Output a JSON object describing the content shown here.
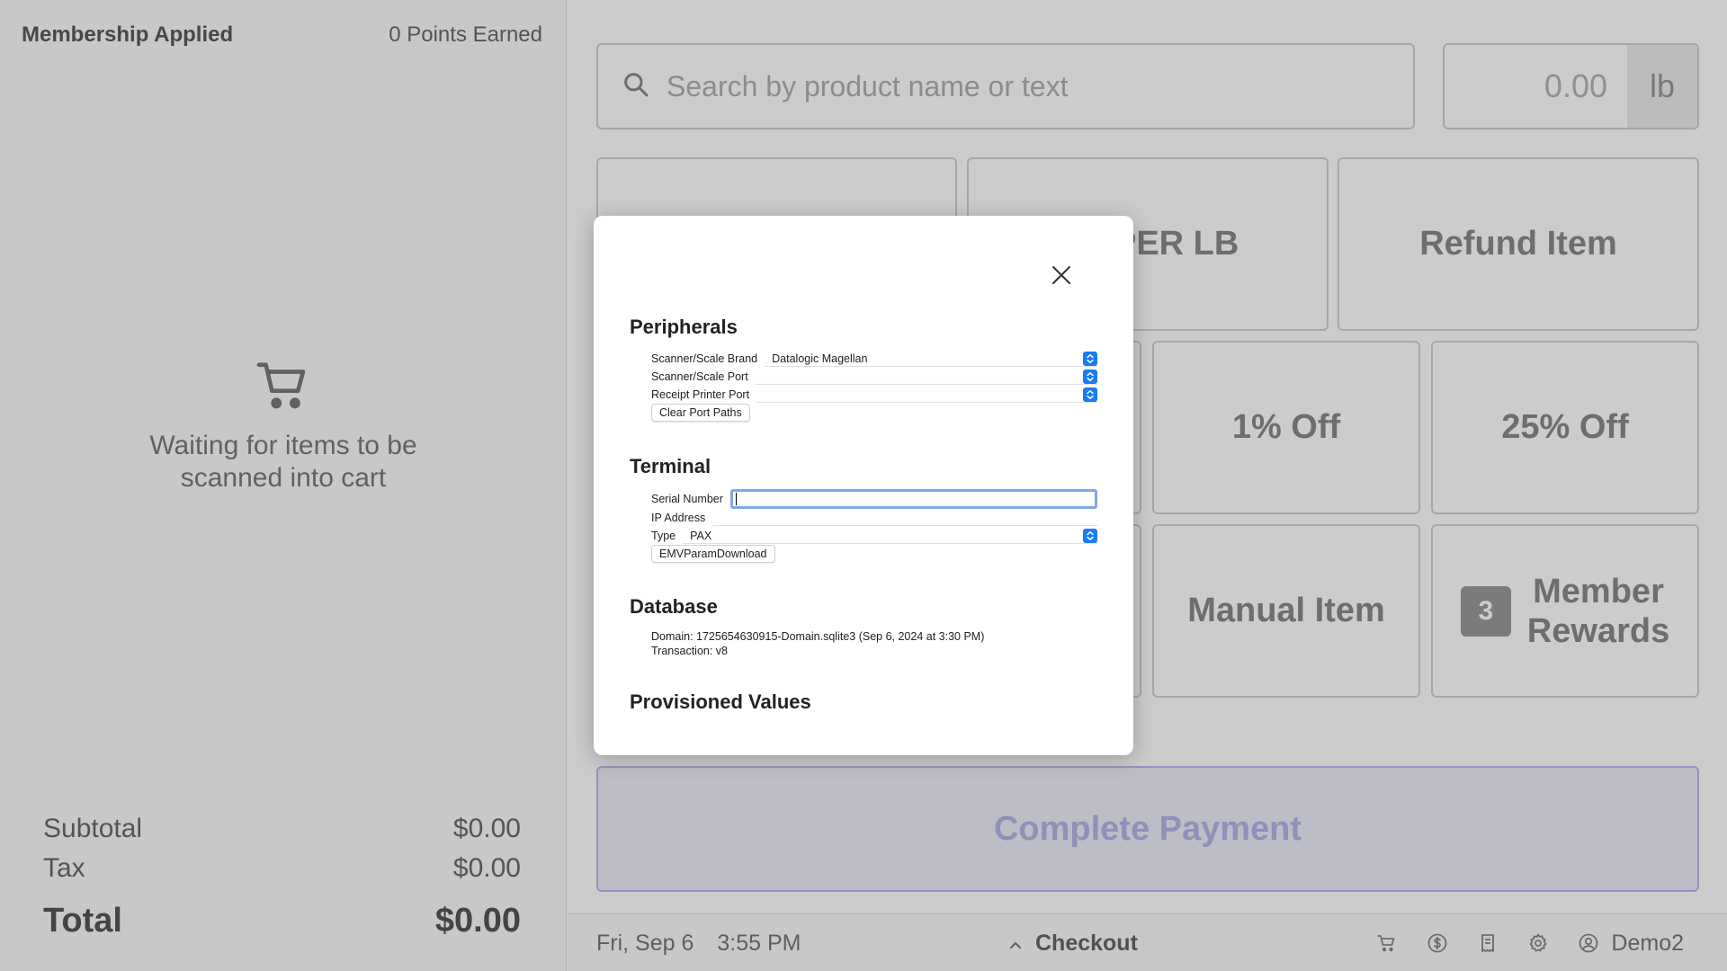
{
  "cart": {
    "membership": "Membership Applied",
    "points": "0 Points Earned",
    "empty_line1": "Waiting for items to be",
    "empty_line2": "scanned into cart",
    "subtotal_label": "Subtotal",
    "subtotal_value": "$0.00",
    "tax_label": "Tax",
    "tax_value": "$0.00",
    "total_label": "Total",
    "total_value": "$0.00"
  },
  "search": {
    "placeholder": "Search by product name or text",
    "icon": "search-icon"
  },
  "weight": {
    "value": "0.00",
    "unit": "lb"
  },
  "tiles": {
    "price_per_lb": "CE PER LB",
    "refund": "Refund Item",
    "one_pct": "1% Off",
    "twenty_five_pct": "25% Off",
    "manual": "Manual Item",
    "rewards_count": "3",
    "rewards_line1": "Member",
    "rewards_line2": "Rewards"
  },
  "pay": {
    "label": "Complete Payment"
  },
  "statusbar": {
    "date": "Fri, Sep 6",
    "time": "3:55 PM",
    "checkout": "Checkout",
    "user": "Demo2",
    "icons": [
      "cart-icon",
      "dollar-icon",
      "receipt-icon",
      "gear-icon",
      "user-icon"
    ]
  },
  "modal": {
    "peripherals": {
      "title": "Peripherals",
      "scanner_brand_label": "Scanner/Scale Brand",
      "scanner_brand_value": "Datalogic Magellan",
      "scanner_port_label": "Scanner/Scale Port",
      "scanner_port_value": "",
      "printer_port_label": "Receipt Printer Port",
      "printer_port_value": "",
      "clear_button": "Clear Port Paths"
    },
    "terminal": {
      "title": "Terminal",
      "serial_label": "Serial Number",
      "serial_value": "",
      "ip_label": "IP Address",
      "ip_value": "",
      "type_label": "Type",
      "type_value": "PAX",
      "emv_button": "EMVParamDownload"
    },
    "database": {
      "title": "Database",
      "domain_line": "Domain: 1725654630915-Domain.sqlite3 (Sep 6, 2024 at 3:30 PM)",
      "transaction_line": "Transaction: v8"
    },
    "provisioned": {
      "title": "Provisioned Values"
    }
  },
  "colors": {
    "accent": "#1a7cf0",
    "pay_background": "#ededfb",
    "pay_text": "#b5b5e8"
  }
}
